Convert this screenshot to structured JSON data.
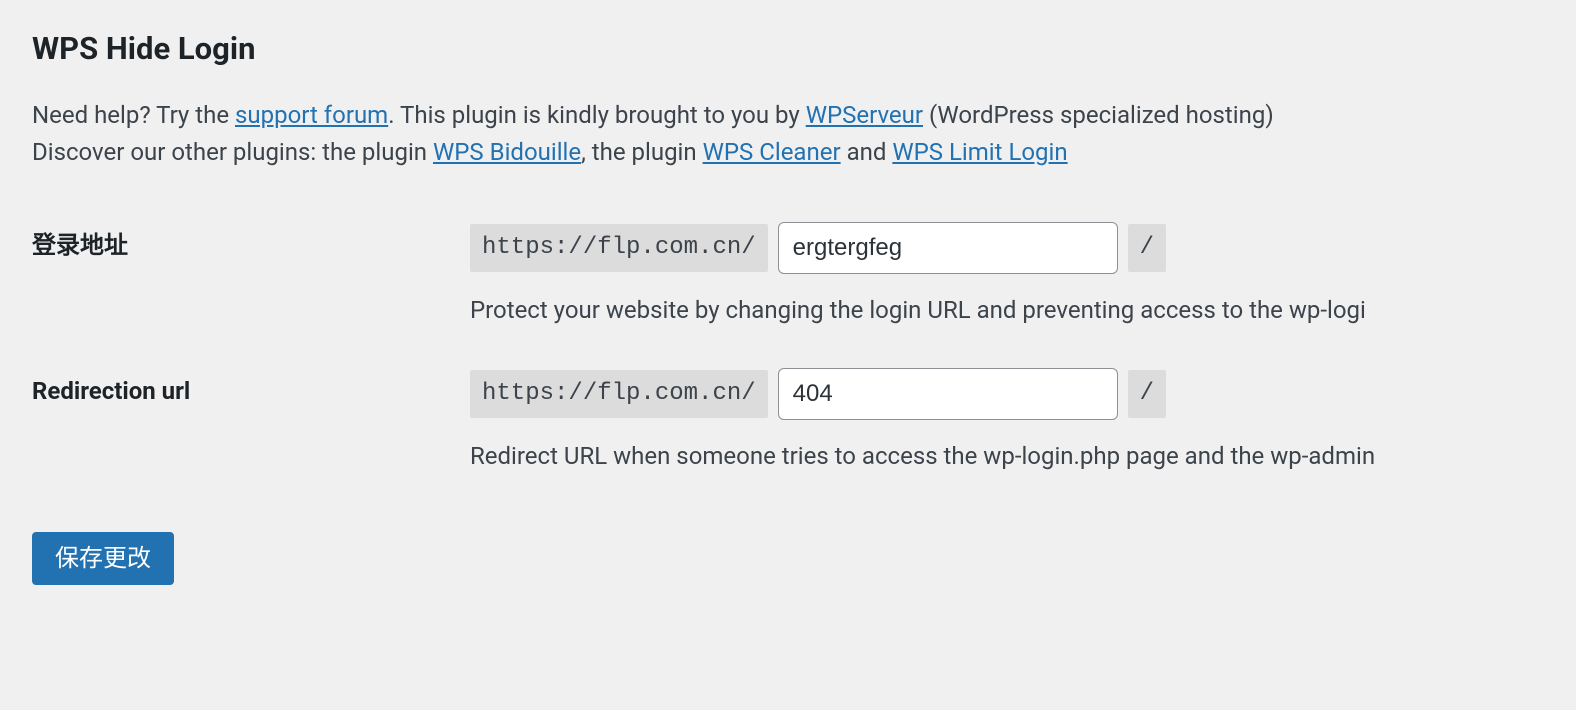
{
  "section": {
    "title": "WPS Hide Login",
    "intro": {
      "text1": "Need help? Try the ",
      "link1": "support forum",
      "text2": ". This plugin is kindly brought to you by ",
      "link2": "WPServeur",
      "text3": " (WordPress specialized hosting)",
      "text4": "Discover our other plugins: the plugin ",
      "link3": "WPS Bidouille",
      "text5": ", the plugin ",
      "link4": "WPS Cleaner",
      "text6": " and ",
      "link5": "WPS Limit Login"
    }
  },
  "fields": {
    "login_url": {
      "label": "登录地址",
      "prefix": "https://flp.com.cn/",
      "value": "ergtergfeg",
      "suffix": "/",
      "description": "Protect your website by changing the login URL and preventing access to the wp-logi"
    },
    "redirect_url": {
      "label": "Redirection url",
      "prefix": "https://flp.com.cn/",
      "value": "404",
      "suffix": "/",
      "description": "Redirect URL when someone tries to access the wp-login.php page and the wp-admin"
    }
  },
  "submit": {
    "label": "保存更改"
  }
}
